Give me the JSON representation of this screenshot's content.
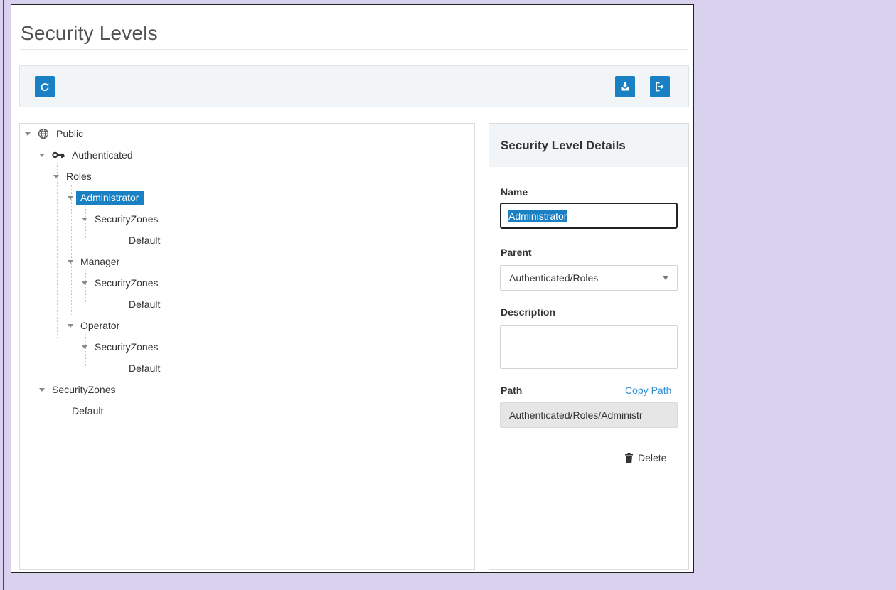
{
  "page": {
    "title": "Security Levels"
  },
  "toolbar": {
    "refresh_icon": "refresh-icon",
    "import_icon": "import-icon",
    "exit_icon": "exit-icon",
    "accent_color": "#1a80c4"
  },
  "tree": {
    "public": "Public",
    "authenticated": "Authenticated",
    "roles": "Roles",
    "administrator": "Administrator",
    "admin_security_zones": "SecurityZones",
    "admin_default": "Default",
    "manager": "Manager",
    "manager_security_zones": "SecurityZones",
    "manager_default": "Default",
    "operator": "Operator",
    "operator_security_zones": "SecurityZones",
    "operator_default": "Default",
    "security_zones": "SecurityZones",
    "default": "Default",
    "selected": "Administrator"
  },
  "details": {
    "title": "Security Level Details",
    "name_label": "Name",
    "name_value": "Administrator",
    "parent_label": "Parent",
    "parent_value": "Authenticated/Roles",
    "description_label": "Description",
    "description_value": "",
    "path_label": "Path",
    "copy_path": "Copy Path",
    "path_value": "Authenticated/Roles/Administr",
    "delete_label": "Delete"
  }
}
